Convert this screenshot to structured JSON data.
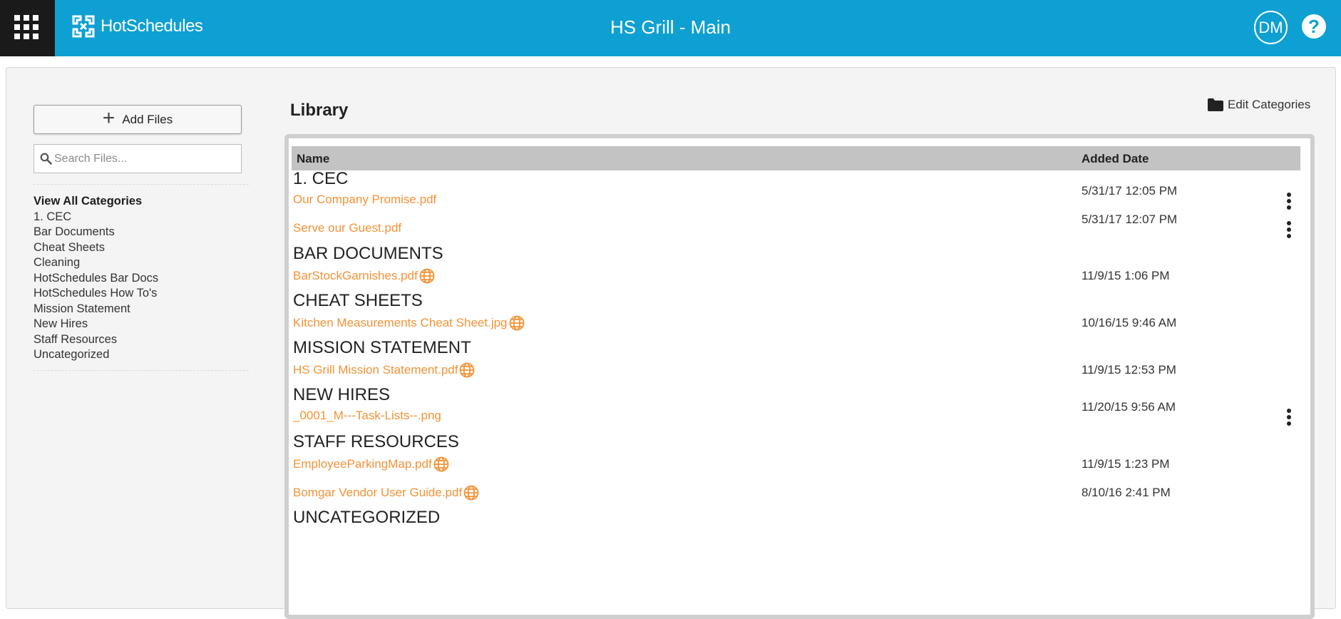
{
  "header": {
    "logo_text": "HotSchedules",
    "title": "HS Grill - Main",
    "avatar_initials": "DM",
    "help_label": "?",
    "brand_color": "#0ea0d2"
  },
  "sidebar": {
    "add_files_label": "Add Files",
    "search_placeholder": "Search Files...",
    "categories": [
      {
        "label": "View All Categories",
        "active": true
      },
      {
        "label": "1. CEC"
      },
      {
        "label": "Bar Documents"
      },
      {
        "label": "Cheat Sheets"
      },
      {
        "label": "Cleaning"
      },
      {
        "label": "HotSchedules Bar Docs"
      },
      {
        "label": "HotSchedules How To's"
      },
      {
        "label": "Mission Statement"
      },
      {
        "label": "New Hires"
      },
      {
        "label": "Staff Resources"
      },
      {
        "label": "Uncategorized"
      }
    ]
  },
  "library": {
    "title": "Library",
    "edit_categories_label": "Edit Categories",
    "columns": {
      "name": "Name",
      "added_date": "Added Date"
    },
    "link_color": "#f39237",
    "groups": [
      {
        "title": "1. CEC",
        "files": [
          {
            "name": "Our Company Promise.pdf",
            "date": "5/31/17 12:05 PM",
            "globe": false,
            "menu": true
          },
          {
            "name": "Serve our Guest.pdf",
            "date": "5/31/17 12:07 PM",
            "globe": false,
            "menu": true
          }
        ]
      },
      {
        "title": "BAR DOCUMENTS",
        "files": [
          {
            "name": "BarStockGarnishes.pdf",
            "date": "11/9/15 1:06 PM",
            "globe": true,
            "menu": false
          }
        ]
      },
      {
        "title": "CHEAT SHEETS",
        "files": [
          {
            "name": "Kitchen Measurements Cheat Sheet.jpg",
            "date": "10/16/15 9:46 AM",
            "globe": true,
            "menu": false
          }
        ]
      },
      {
        "title": "MISSION STATEMENT",
        "files": [
          {
            "name": "HS Grill Mission Statement.pdf",
            "date": "11/9/15 12:53 PM",
            "globe": true,
            "menu": false
          }
        ]
      },
      {
        "title": "NEW HIRES",
        "files": [
          {
            "name": "_0001_M---Task-Lists--.png",
            "date": "11/20/15 9:56 AM",
            "globe": false,
            "menu": true
          }
        ]
      },
      {
        "title": "STAFF RESOURCES",
        "files": [
          {
            "name": "EmployeeParkingMap.pdf",
            "date": "11/9/15 1:23 PM",
            "globe": true,
            "menu": false
          },
          {
            "name": "Bomgar Vendor User Guide.pdf",
            "date": "8/10/16 2:41 PM",
            "globe": true,
            "menu": false
          }
        ]
      },
      {
        "title": "UNCATEGORIZED",
        "files": []
      }
    ]
  }
}
